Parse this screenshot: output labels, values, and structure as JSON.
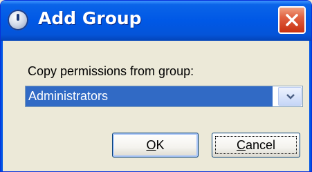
{
  "window": {
    "title": "Add Group",
    "icon": "info-icon",
    "title_color": "#ffffff",
    "titlebar_color": "#0058e6"
  },
  "dialog": {
    "label": "Copy permissions from group:",
    "group_select": {
      "selected_value": "Administrators",
      "highlight_color": "#316ac5"
    },
    "ok_button": {
      "accel": "O",
      "rest": "K"
    },
    "cancel_button": {
      "accel": "C",
      "rest": "ancel"
    }
  }
}
